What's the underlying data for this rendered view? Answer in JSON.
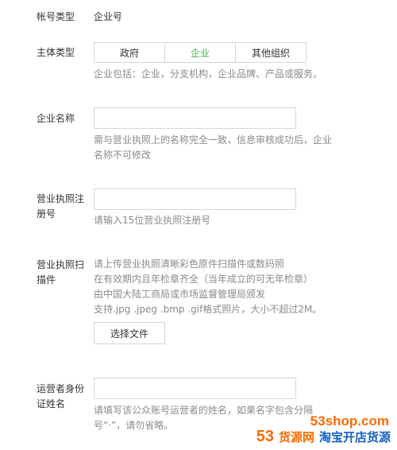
{
  "account_type": {
    "label": "帐号类型",
    "value": "企业号"
  },
  "entity_type": {
    "label": "主体类型",
    "options": [
      "政府",
      "企业",
      "其他组织"
    ],
    "selected": "企业",
    "hint": "企业包括：企业，分支机构，企业品牌、产品或服务。"
  },
  "company_name": {
    "label": "企业名称",
    "value": "",
    "hint_line1": "需与营业执照上的名称完全一致，信息审核成功后，企业",
    "hint_line2": "名称不可修改"
  },
  "license_number": {
    "label_line1": "营业执照注",
    "label_line2": "册号",
    "value": "",
    "hint": "请输入15位营业执照注册号"
  },
  "license_scan": {
    "label_line1": "营业执照扫",
    "label_line2": "描件",
    "hint_line1": "请上传营业执照清晰彩色原件扫描件或数码照",
    "hint_line2": "在有效期内且年检章齐全（当年成立的可无年检章）",
    "hint_line3": "由中国大陆工商局或市场监督管理局颁发",
    "hint_line4": "支持.jpg .jpeg .bmp .gif格式照片，大小不超过2M。",
    "button": "选择文件"
  },
  "operator_name": {
    "label_line1": "运营者身份",
    "label_line2": "证姓名",
    "value": "",
    "hint_line1": "请填写该公众账号运营者的姓名，如果名字包含分隔",
    "hint_line2": "号“·”，请勿省略。"
  },
  "watermark": {
    "url": "53shop.com",
    "brand_num": "53",
    "brand_text": "货源网",
    "slogan": "淘宝开店货源"
  }
}
